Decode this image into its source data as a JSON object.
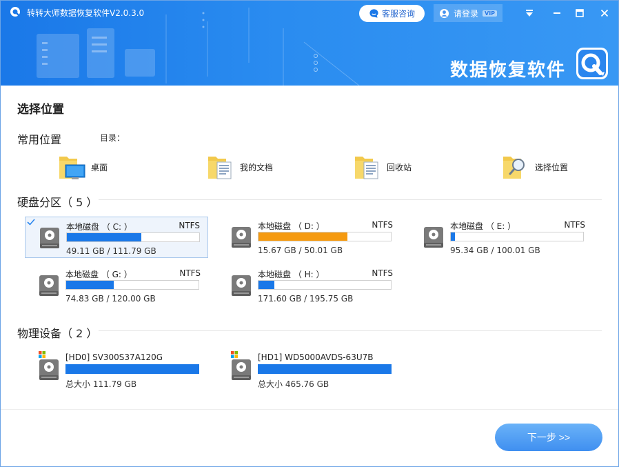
{
  "app": {
    "title": "转转大师数据恢复软件V2.0.3.0",
    "brand_text": "数据恢复软件"
  },
  "header": {
    "service_label": "客服咨询",
    "login_label": "请登录",
    "vip_badge": "VIP"
  },
  "page": {
    "title": "选择位置"
  },
  "common": {
    "heading": "常用位置",
    "dir_label": "目录：",
    "items": [
      {
        "label": "桌面",
        "icon": "desktop-folder-icon"
      },
      {
        "label": "我的文档",
        "icon": "documents-folder-icon"
      },
      {
        "label": "回收站",
        "icon": "recycle-bin-folder-icon"
      },
      {
        "label": "选择位置",
        "icon": "search-folder-icon"
      }
    ]
  },
  "partitions": {
    "heading": "硬盘分区",
    "count": "（ 5 ）",
    "items": [
      {
        "name": "本地磁盘 （ C: ）",
        "fs": "NTFS",
        "size": "49.11 GB / 111.79 GB",
        "used": 0.56,
        "color": "#1a78e8",
        "selected": true
      },
      {
        "name": "本地磁盘 （ D: ）",
        "fs": "NTFS",
        "size": "15.67 GB / 50.01 GB",
        "used": 0.67,
        "color": "#f59a10",
        "selected": false
      },
      {
        "name": "本地磁盘 （ E: ）",
        "fs": "NTFS",
        "size": "95.34 GB / 100.01 GB",
        "used": 0.03,
        "color": "#1a78e8",
        "selected": false
      },
      {
        "name": "本地磁盘 （ G: ）",
        "fs": "NTFS",
        "size": "74.83 GB / 120.00 GB",
        "used": 0.36,
        "color": "#1a78e8",
        "selected": false
      },
      {
        "name": "本地磁盘 （ H: ）",
        "fs": "NTFS",
        "size": "171.60 GB / 195.75 GB",
        "used": 0.12,
        "color": "#1a78e8",
        "selected": false
      }
    ]
  },
  "devices": {
    "heading": "物理设备",
    "count": "（ 2 ）",
    "items": [
      {
        "name": "[HD0] SV300S37A120G",
        "size": "总大小 111.79 GB"
      },
      {
        "name": "[HD1] WD5000AVDS-63U7B",
        "size": "总大小 465.76 GB"
      }
    ]
  },
  "footer": {
    "next_label": "下一步 >>"
  },
  "colors": {
    "accent": "#1a78e8",
    "warning": "#f59a10"
  }
}
